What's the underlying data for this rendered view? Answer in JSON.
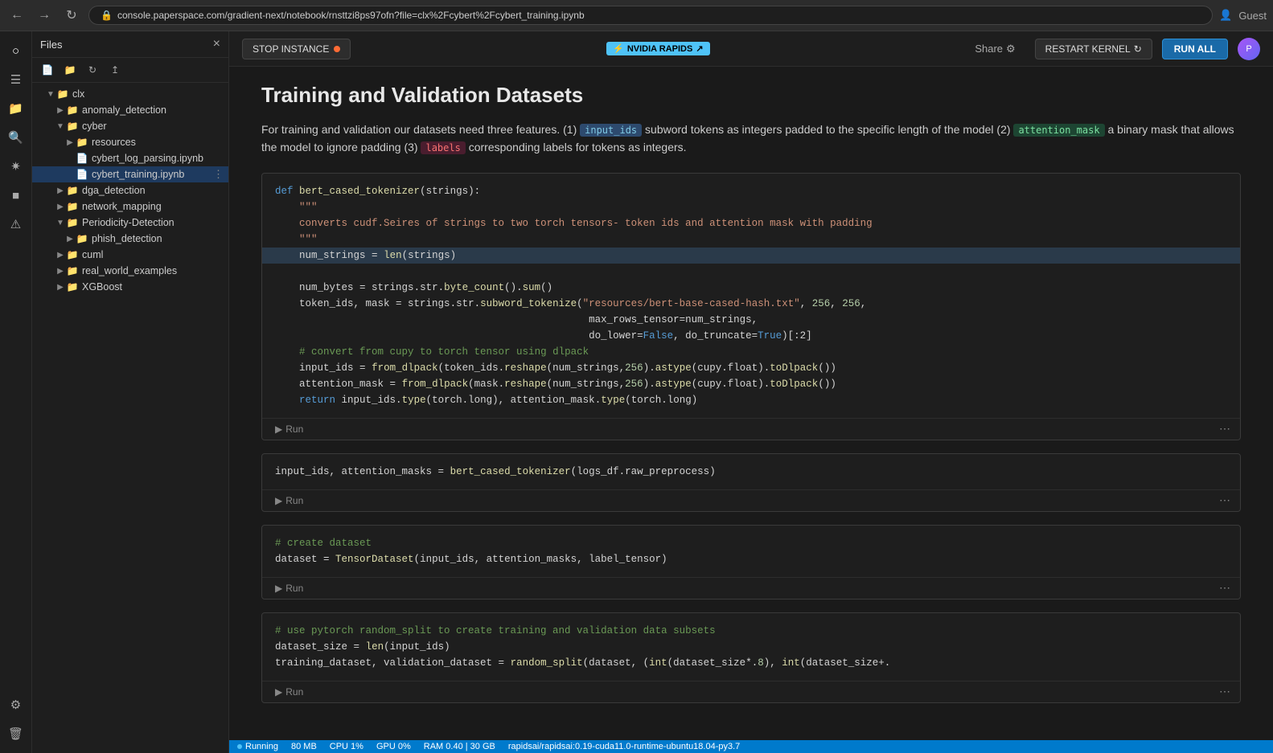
{
  "browser": {
    "url": "console.paperspace.com/gradient-next/notebook/rnsttzi8ps97ofn?file=clx%2Fcybert%2Fcybert_training.ipynb",
    "user": "Guest"
  },
  "header": {
    "stop_instance_label": "STOP INSTANCE",
    "rapids_label": "NVIDIA RAPIDS",
    "share_label": "Share",
    "restart_kernel_label": "RESTART KERNEL",
    "run_all_label": "RUN ALL"
  },
  "files_panel": {
    "title": "Files",
    "close_icon": "×"
  },
  "file_tree": {
    "root": "clx",
    "items": [
      {
        "level": 1,
        "type": "folder-open",
        "name": "anomaly_detection",
        "expanded": true
      },
      {
        "level": 1,
        "type": "folder-open",
        "name": "cyber",
        "expanded": true
      },
      {
        "level": 2,
        "type": "folder",
        "name": "resources"
      },
      {
        "level": 2,
        "type": "file-nb",
        "name": "cybert_log_parsing.ipynb"
      },
      {
        "level": 2,
        "type": "file-nb-active",
        "name": "cybert_training.ipynb",
        "active": true
      },
      {
        "level": 1,
        "type": "folder",
        "name": "dga_detection"
      },
      {
        "level": 1,
        "type": "folder",
        "name": "network_mapping"
      },
      {
        "level": 1,
        "type": "folder-open",
        "name": "Periodicity-Detection",
        "expanded": true
      },
      {
        "level": 2,
        "type": "folder",
        "name": "phish_detection"
      },
      {
        "level": 1,
        "type": "folder",
        "name": "cuml"
      },
      {
        "level": 1,
        "type": "folder",
        "name": "real_world_examples"
      },
      {
        "level": 1,
        "type": "folder",
        "name": "XGBoost"
      }
    ]
  },
  "notebook": {
    "title": "Training and Validation Datasets",
    "description_before": "For training and validation our datasets need three features. (1) ",
    "code1": "input_ids",
    "description_middle1": " subword tokens as integers padded to the specific length of the model (2) ",
    "code2": "attention_mask",
    "description_middle2": " a binary mask that allows the model to ignore padding (3) ",
    "code3": "labels",
    "description_after": " corresponding labels for tokens as integers.",
    "cells": [
      {
        "id": "cell1",
        "run_label": "Run",
        "code": "def bert_cased_tokenizer(strings):\n    \"\"\"\n    converts cudf.Seires of strings to two torch tensors- token ids and attention mask with padding\n    \"\"\"\n    num_strings = len(strings)\n    num_bytes = strings.str.byte_count().sum()\n    token_ids, mask = strings.str.subword_tokenize(\"resources/bert-base-cased-hash.txt\", 256, 256,\n                                                    max_rows_tensor=num_strings,\n                                                    do_lower=False, do_truncate=True)[:2]\n    # convert from cupy to torch tensor using dlpack\n    input_ids = from_dlpack(token_ids.reshape(num_strings,256).astype(cupy.float).toDlpack())\n    attention_mask = from_dlpack(mask.reshape(num_strings,256).astype(cupy.float).toDlpack())\n    return input_ids.type(torch.long), attention_mask.type(torch.long)"
      },
      {
        "id": "cell2",
        "run_label": "Run",
        "code": "input_ids, attention_masks = bert_cased_tokenizer(logs_df.raw_preprocess)"
      },
      {
        "id": "cell3",
        "run_label": "Run",
        "code": "# create dataset\ndataset = TensorDataset(input_ids, attention_masks, label_tensor)"
      },
      {
        "id": "cell4",
        "run_label": "Run",
        "code": "# use pytorch random_split to create training and validation data subsets\ndataset_size = len(input_ids)\ntraining_dataset, validation_dataset = random_split(dataset, (int(dataset_size*.8), int(dataset_size+."
      }
    ]
  },
  "status_bar": {
    "running_label": "Running",
    "memory": "80 MB",
    "cpu": "1%",
    "gpu": "0%",
    "ram": "0.40 | 30 GB",
    "env": "rapidsai/rapidsai:0.19-cuda11.0-runtime-ubuntu18.04-py3.7"
  }
}
